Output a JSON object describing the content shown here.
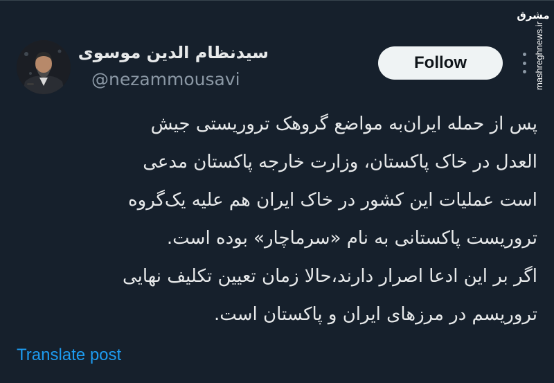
{
  "watermark": {
    "logo_text": "مشرق",
    "url": "mashreghnews.ir"
  },
  "author": {
    "display_name": "سیدنظام الدین موسوی",
    "handle": "@nezammousavi"
  },
  "actions": {
    "follow_label": "Follow",
    "more_icon": "more-vertical-icon"
  },
  "tweet": {
    "lines": [
      "پس از حمله ایران‌به مواضع گروهک تروریستی جیش",
      "العدل در خاک پاکستان، وزارت خارجه پاکستان مدعی",
      "است عملیات این کشور در خاک ایران هم علیه یک‌گروه",
      "تروریست پاکستانی به نام «سرماچار» بوده است.",
      "اگر بر این ادعا اصرار دارند،حالا زمان تعیین تکلیف نهایی",
      "تروریسم در مرزهای ایران و پاکستان است."
    ]
  },
  "translate_label": "Translate post",
  "colors": {
    "background": "#16202c",
    "text": "#e7e9ea",
    "secondary": "#8b98a5",
    "link": "#1d9bf0",
    "button_bg": "#eff3f4"
  }
}
